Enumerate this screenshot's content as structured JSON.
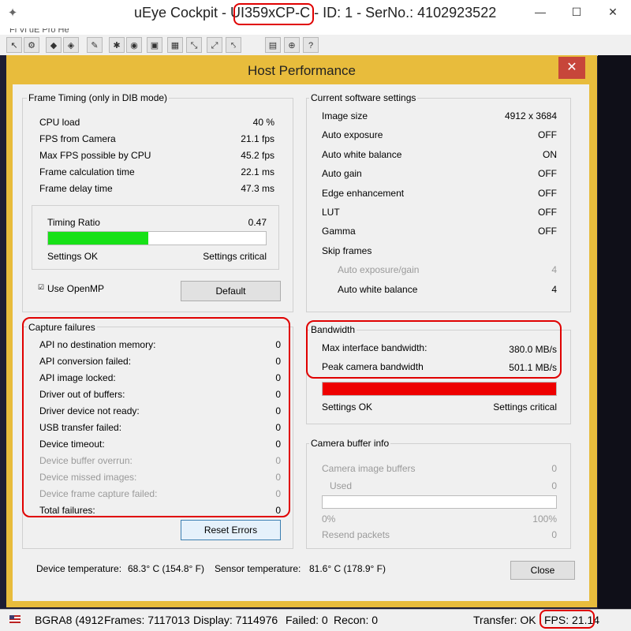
{
  "window": {
    "title_prefix": "uEye Cockpit - ",
    "title_model": "UI359xCP-C",
    "title_suffix": " - ID: 1 - SerNo.: 4102923522",
    "minimize": "—",
    "maximize": "☐",
    "close": "✕",
    "menu_fragment": "Fi  Vi  uE  Pro  He"
  },
  "toolbar": {
    "buttons": [
      "cursor-icon",
      "settings-icon",
      "capture-icon",
      "record-icon",
      "wrench-icon",
      "gear-icon",
      "color-icon",
      "save-icon",
      "grid-icon",
      "zoom-icon",
      "measure-icon",
      "chart-icon",
      "zoom-in-icon",
      "help-icon"
    ]
  },
  "dialog": {
    "title": "Host Performance",
    "close": "✕",
    "frame_timing": {
      "title": "Frame Timing (only in DIB mode)",
      "rows": [
        {
          "label": "CPU load",
          "value": "40 %"
        },
        {
          "label": "FPS from Camera",
          "value": "21.1 fps"
        },
        {
          "label": "Max FPS possible by CPU",
          "value": "45.2 fps"
        },
        {
          "label": "Frame calculation time",
          "value": "22.1 ms"
        },
        {
          "label": "Frame delay time",
          "value": "47.3 ms"
        }
      ],
      "timing_ratio_label": "Timing Ratio",
      "timing_ratio_value": "0.47",
      "timing_ratio_fraction": 0.46,
      "timing_bar_color": "#17e117",
      "settings_ok": "Settings OK",
      "settings_critical": "Settings critical",
      "use_openmp_label": "Use OpenMP",
      "default_button": "Default"
    },
    "capture_failures": {
      "title": "Capture failures",
      "rows": [
        {
          "label": "API no destination memory:",
          "value": "0",
          "enabled": true
        },
        {
          "label": "API conversion failed:",
          "value": "0",
          "enabled": true
        },
        {
          "label": "API image locked:",
          "value": "0",
          "enabled": true
        },
        {
          "label": "Driver out of buffers:",
          "value": "0",
          "enabled": true
        },
        {
          "label": "Driver device not ready:",
          "value": "0",
          "enabled": true
        },
        {
          "label": "USB transfer failed:",
          "value": "0",
          "enabled": true
        },
        {
          "label": "Device timeout:",
          "value": "0",
          "enabled": true
        },
        {
          "label": "Device buffer overrun:",
          "value": "0",
          "enabled": false
        },
        {
          "label": "Device missed images:",
          "value": "0",
          "enabled": false
        },
        {
          "label": "Device frame capture failed:",
          "value": "0",
          "enabled": false
        },
        {
          "label": "Total failures:",
          "value": "0",
          "enabled": true
        }
      ],
      "reset_button": "Reset Errors"
    },
    "software_settings": {
      "title": "Current software settings",
      "rows": [
        {
          "label": "Image size",
          "value": "4912 x 3684",
          "enabled": true,
          "indent": false
        },
        {
          "label": "Auto exposure",
          "value": "OFF",
          "enabled": true,
          "indent": false
        },
        {
          "label": "Auto white balance",
          "value": "ON",
          "enabled": true,
          "indent": false
        },
        {
          "label": "Auto gain",
          "value": "OFF",
          "enabled": true,
          "indent": false
        },
        {
          "label": "Edge enhancement",
          "value": "OFF",
          "enabled": true,
          "indent": false
        },
        {
          "label": "LUT",
          "value": "OFF",
          "enabled": true,
          "indent": false
        },
        {
          "label": "Gamma",
          "value": "OFF",
          "enabled": true,
          "indent": false
        },
        {
          "label": "Skip frames",
          "value": "",
          "enabled": true,
          "indent": false
        },
        {
          "label": "Auto exposure/gain",
          "value": "4",
          "enabled": false,
          "indent": true
        },
        {
          "label": "Auto white balance",
          "value": "4",
          "enabled": true,
          "indent": true
        }
      ]
    },
    "bandwidth": {
      "title": "Bandwidth",
      "rows": [
        {
          "label": "Max interface bandwidth:",
          "value": "380.0 MB/s"
        },
        {
          "label": "Peak camera bandwidth",
          "value": "501.1 MB/s"
        }
      ],
      "bar_fraction": 1.0,
      "bar_color": "#ee0000",
      "settings_ok": "Settings OK",
      "settings_critical": "Settings critical"
    },
    "camera_buffer": {
      "title": "Camera buffer info",
      "camera_image_buffers_label": "Camera image buffers",
      "camera_image_buffers_value": "0",
      "used_label": "Used",
      "used_value": "0",
      "bar_fraction": 0.0,
      "min_label": "0%",
      "max_label": "100%",
      "resend_label": "Resend packets",
      "resend_value": "0"
    },
    "device_temperature_label": "Device temperature:",
    "device_temperature_value": "68.3° C  (154.8° F)",
    "sensor_temperature_label": "Sensor temperature:",
    "sensor_temperature_value": "81.6° C  (178.9° F)",
    "close_button": "Close"
  },
  "statusbar": {
    "format": "BGRA8 (4912",
    "frames": "Frames: 7117013",
    "display": "Display: 7114976",
    "failed": "Failed: 0",
    "recon": "Recon: 0",
    "transfer": "Transfer: OK",
    "fps": "FPS: 21.14"
  },
  "colors": {
    "dialog_border": "#e8bc3c",
    "highlight_red": "#e00000",
    "close_red": "#c7463a"
  }
}
